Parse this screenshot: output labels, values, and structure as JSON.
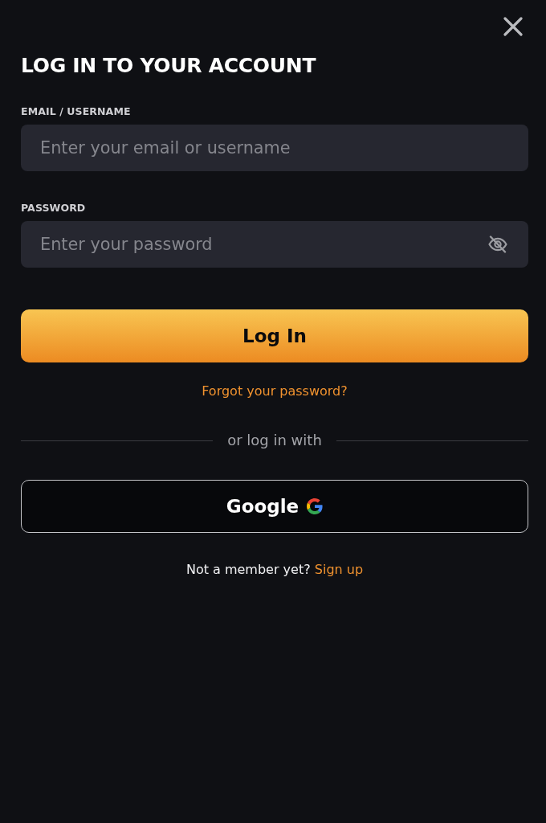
{
  "title": "LOG IN TO YOUR ACCOUNT",
  "fields": [
    {
      "kind": "text",
      "label": "EMAIL / USERNAME",
      "placeholder": "Enter your email or username"
    },
    {
      "kind": "password",
      "label": "PASSWORD",
      "placeholder": "Enter your password"
    }
  ],
  "login_button": {
    "label": "Log In"
  },
  "forgot_link": {
    "label": "Forgot your password?"
  },
  "divider_text": "or log in with",
  "social_buttons": [
    {
      "kind": "google",
      "label": "Google"
    }
  ],
  "signup": {
    "prompt": "Not a member yet?",
    "link": "Sign up"
  }
}
